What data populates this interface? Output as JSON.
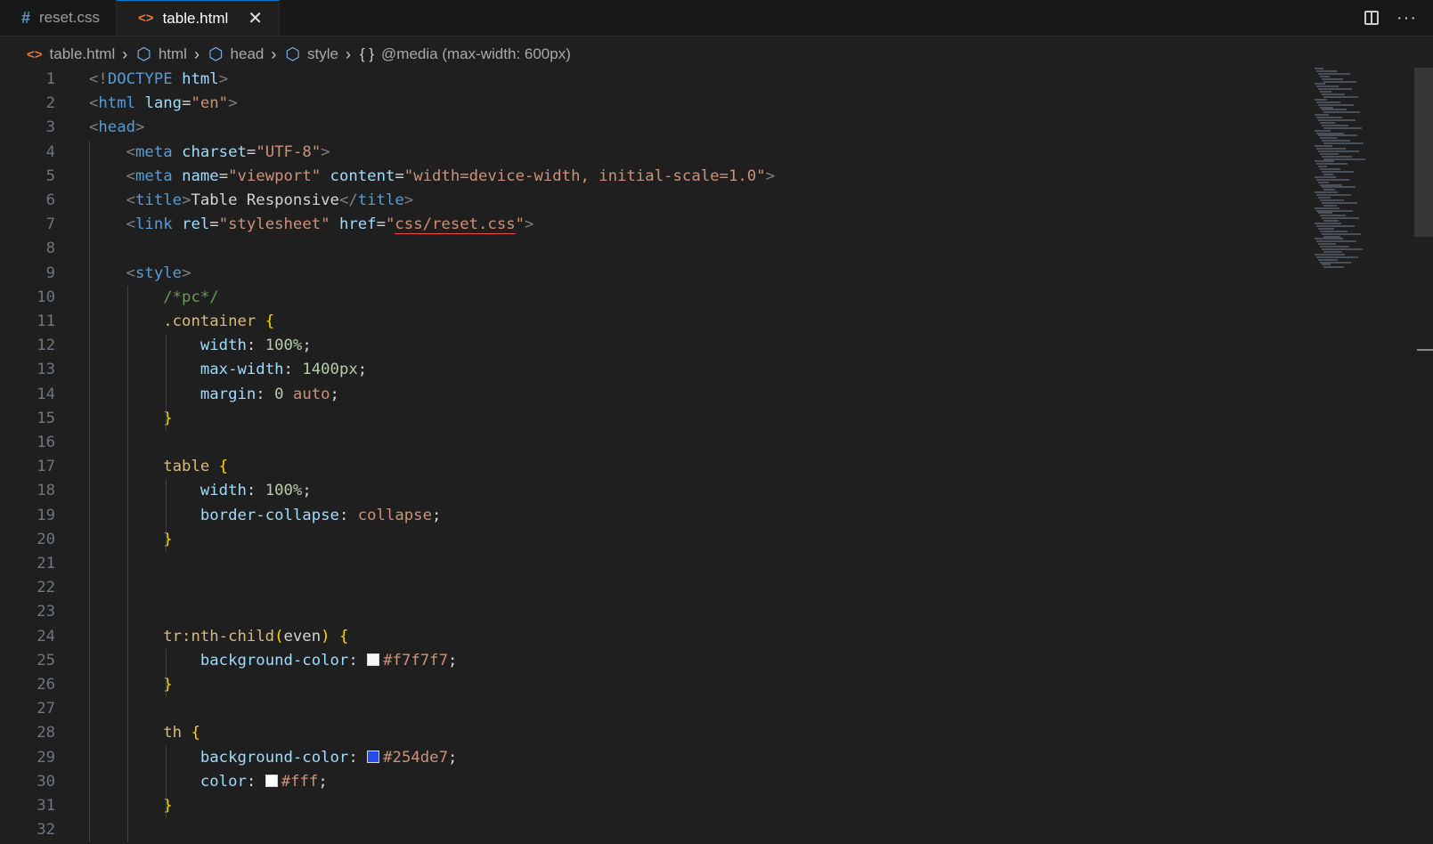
{
  "tabs": [
    {
      "icon": "#",
      "label": "reset.css"
    },
    {
      "icon": "<>",
      "label": "table.html",
      "close": "✕"
    }
  ],
  "actions": {
    "more": "···"
  },
  "breadcrumb": [
    "table.html",
    "html",
    "head",
    "style",
    "@media (max-width: 600px)"
  ],
  "breadcrumb_brace_icon": "{ }",
  "swatches": {
    "f7f7f7": "#f7f7f7",
    "254de7": "#254de7",
    "fff": "#ffffff"
  },
  "code_lines": [
    {
      "n": "1",
      "text": "<!DOCTYPE html>"
    },
    {
      "n": "2",
      "text": "<html lang=\"en\">"
    },
    {
      "n": "3",
      "text": "<head>"
    },
    {
      "n": "4",
      "text": "    <meta charset=\"UTF-8\">"
    },
    {
      "n": "5",
      "text": "    <meta name=\"viewport\" content=\"width=device-width, initial-scale=1.0\">"
    },
    {
      "n": "6",
      "text": "    <title>Table Responsive</title>"
    },
    {
      "n": "7",
      "text": "    <link rel=\"stylesheet\" href=\"css/reset.css\">"
    },
    {
      "n": "8",
      "text": ""
    },
    {
      "n": "9",
      "text": "    <style>"
    },
    {
      "n": "10",
      "text": "        /*pc*/"
    },
    {
      "n": "11",
      "text": "        .container {"
    },
    {
      "n": "12",
      "text": "            width: 100%;"
    },
    {
      "n": "13",
      "text": "            max-width: 1400px;"
    },
    {
      "n": "14",
      "text": "            margin: 0 auto;"
    },
    {
      "n": "15",
      "text": "        }"
    },
    {
      "n": "16",
      "text": ""
    },
    {
      "n": "17",
      "text": "        table {"
    },
    {
      "n": "18",
      "text": "            width: 100%;"
    },
    {
      "n": "19",
      "text": "            border-collapse: collapse;"
    },
    {
      "n": "20",
      "text": "        }"
    },
    {
      "n": "21",
      "text": ""
    },
    {
      "n": "22",
      "text": ""
    },
    {
      "n": "23",
      "text": ""
    },
    {
      "n": "24",
      "text": "        tr:nth-child(even) {"
    },
    {
      "n": "25",
      "text": "            background-color: #f7f7f7;"
    },
    {
      "n": "26",
      "text": "        }"
    },
    {
      "n": "27",
      "text": ""
    },
    {
      "n": "28",
      "text": "        th {"
    },
    {
      "n": "29",
      "text": "            background-color: #254de7;"
    },
    {
      "n": "30",
      "text": "            color: #fff;"
    },
    {
      "n": "31",
      "text": "        }"
    },
    {
      "n": "32",
      "text": ""
    }
  ]
}
